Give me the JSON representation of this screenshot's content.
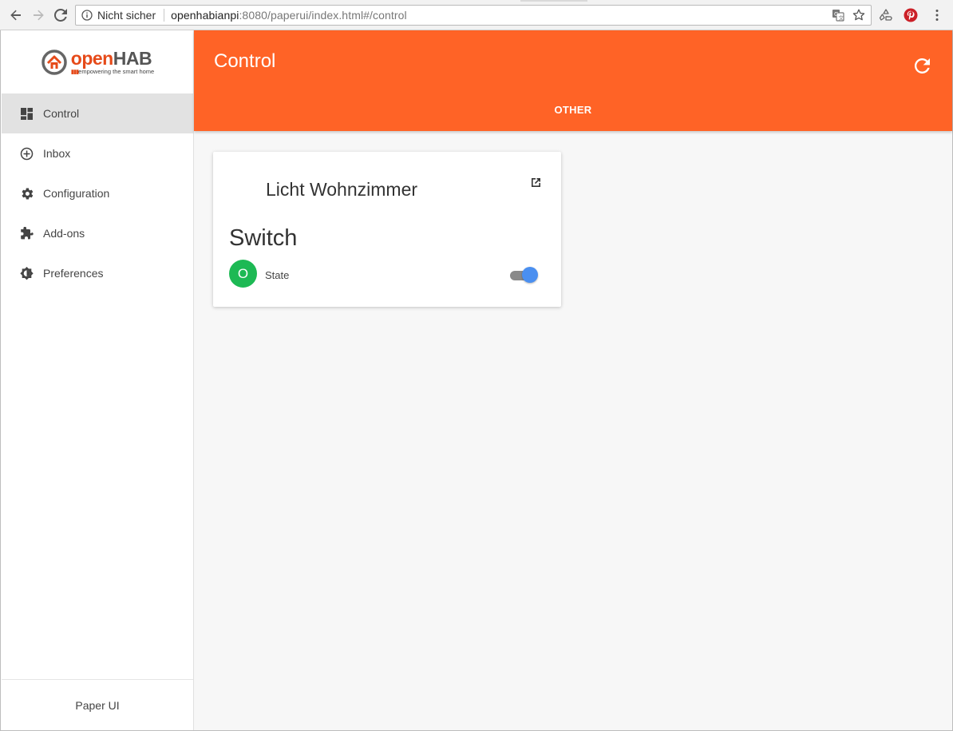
{
  "browser": {
    "security_label": "Nicht sicher",
    "url_host": "openhabianpi",
    "url_rest": ":8080/paperui/index.html#/control"
  },
  "sidebar": {
    "logo": {
      "open": "open",
      "hab": "HAB",
      "dots": "▮▮▮",
      "tagline": "empowering the smart home"
    },
    "items": [
      {
        "label": "Control",
        "icon": "dashboard-icon",
        "active": true
      },
      {
        "label": "Inbox",
        "icon": "add-circle-icon"
      },
      {
        "label": "Configuration",
        "icon": "gear-icon"
      },
      {
        "label": "Add-ons",
        "icon": "puzzle-icon"
      },
      {
        "label": "Preferences",
        "icon": "brightness-icon"
      }
    ],
    "footer": "Paper UI"
  },
  "header": {
    "title": "Control",
    "tab": "OTHER",
    "accent": "#ff6326"
  },
  "card": {
    "title": "Licht Wohnzimmer",
    "subtitle": "Switch",
    "channel": {
      "avatar_letter": "O",
      "label": "State",
      "toggle_on": true
    },
    "avatar_color": "#1db954",
    "toggle_color": "#4a8ff0"
  }
}
